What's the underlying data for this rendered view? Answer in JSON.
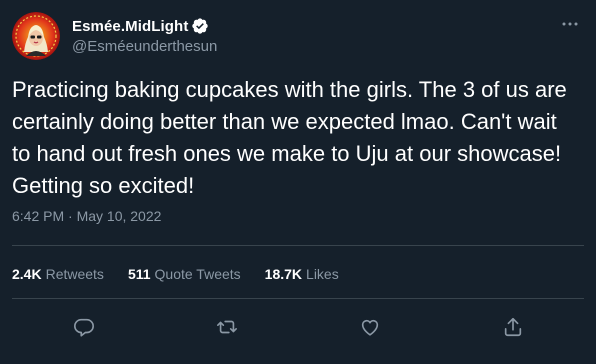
{
  "author": {
    "display_name": "Esmée.MidLight",
    "handle": "@Esméeunderthesun",
    "verified": true,
    "avatar_description_icon": "avatar-portrait"
  },
  "tweet": {
    "text": "Practicing baking cupcakes with the girls. The 3 of us are certainly doing better than we expected lmao. Can't wait to hand out fresh ones we make to Uju at our showcase! Getting so excited!",
    "timestamp": "6:42 PM · May 10, 2022"
  },
  "stats": {
    "retweets_count": "2.4K",
    "retweets_label": "Retweets",
    "quotes_count": "511",
    "quotes_label": "Quote Tweets",
    "likes_count": "18.7K",
    "likes_label": "Likes"
  },
  "actions": [
    "reply-icon",
    "retweet-icon",
    "like-icon",
    "share-icon"
  ],
  "colors": {
    "background": "#15202b",
    "secondary_text": "#8b98a5",
    "divider": "#38444d",
    "verified": "#1d9bf0"
  }
}
